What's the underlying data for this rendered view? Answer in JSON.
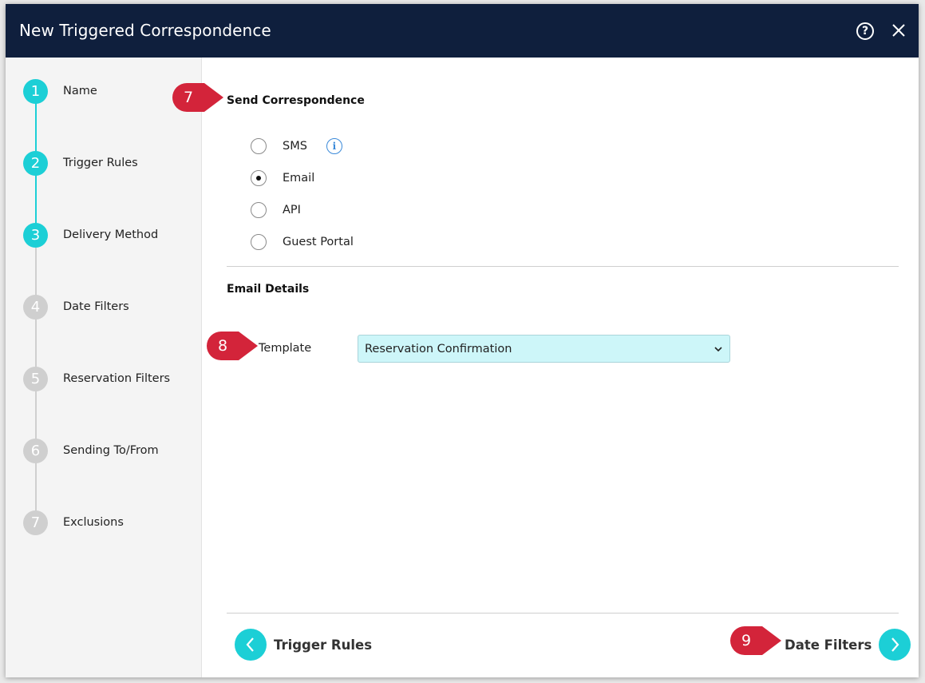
{
  "dialog": {
    "title": "New Triggered Correspondence",
    "help_icon": "question-circle-icon",
    "close_icon": "close-icon"
  },
  "steps": [
    {
      "number": "1",
      "label": "Name",
      "state": "done"
    },
    {
      "number": "2",
      "label": "Trigger Rules",
      "state": "done"
    },
    {
      "number": "3",
      "label": "Delivery Method",
      "state": "current"
    },
    {
      "number": "4",
      "label": "Date Filters",
      "state": "todo"
    },
    {
      "number": "5",
      "label": "Reservation Filters",
      "state": "todo"
    },
    {
      "number": "6",
      "label": "Sending To/From",
      "state": "todo"
    },
    {
      "number": "7",
      "label": "Exclusions",
      "state": "todo"
    }
  ],
  "send_correspondence": {
    "title": "Send Correspondence",
    "options": [
      {
        "label": "SMS",
        "selected": false,
        "has_info": true
      },
      {
        "label": "Email",
        "selected": true,
        "has_info": false
      },
      {
        "label": "API",
        "selected": false,
        "has_info": false
      },
      {
        "label": "Guest Portal",
        "selected": false,
        "has_info": false
      }
    ],
    "info_glyph": "i"
  },
  "email_details": {
    "title": "Email Details",
    "template_label": "Template",
    "template_value": "Reservation Confirmation"
  },
  "navigation": {
    "back_label": "Trigger Rules",
    "next_label": "Date Filters"
  },
  "callouts": [
    "7",
    "8",
    "9"
  ],
  "colors": {
    "header_bg": "#0f1f3d",
    "accent": "#1ccfd6",
    "step_inactive": "#cfcfcf",
    "select_bg": "#cdf6f9",
    "callout_red": "#d3243a",
    "info_blue": "#3b8ad9"
  }
}
